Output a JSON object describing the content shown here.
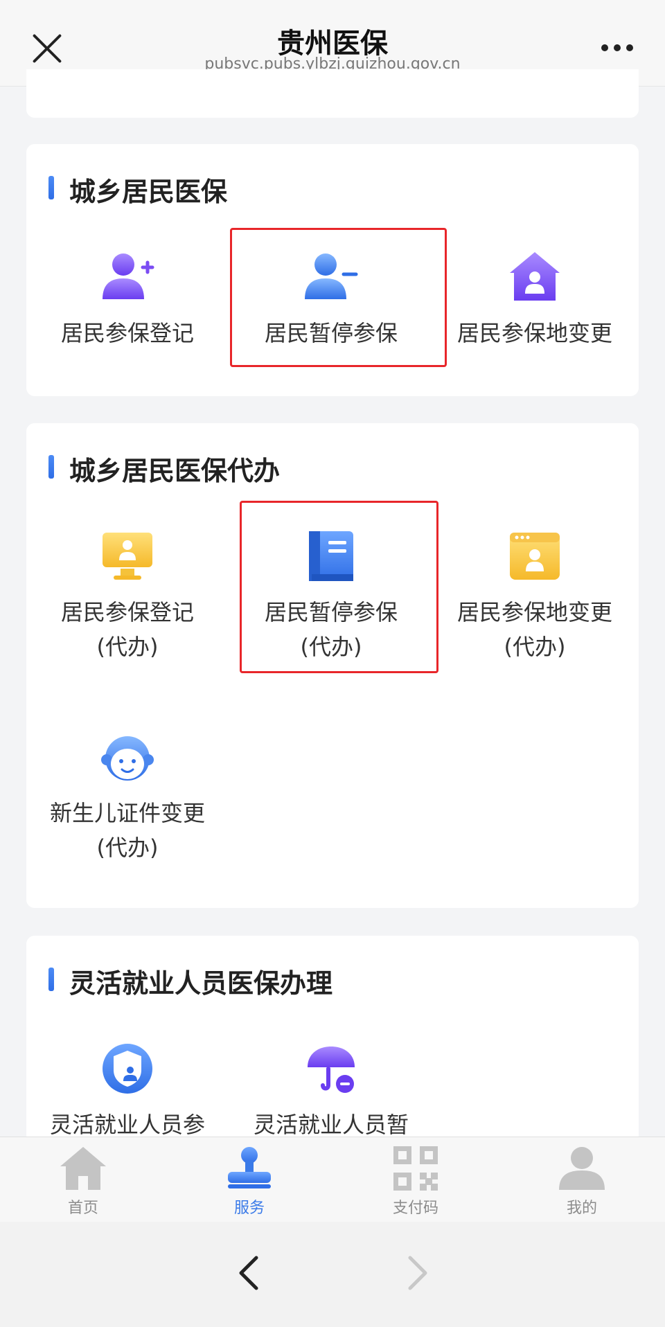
{
  "header": {
    "title": "贵州医保",
    "url": "pubsvc.pubs.ylbzj.guizhou.gov.cn"
  },
  "sections": [
    {
      "title": "城乡居民医保",
      "items": [
        {
          "label": "居民参保登记",
          "icon": "person-add-icon"
        },
        {
          "label": "居民暂停参保",
          "icon": "person-remove-icon"
        },
        {
          "label": "居民参保地变更",
          "icon": "home-person-icon"
        }
      ]
    },
    {
      "title": "城乡居民医保代办",
      "items": [
        {
          "label": "居民参保登记",
          "sub": "(代办)",
          "icon": "monitor-person-icon"
        },
        {
          "label": "居民暂停参保",
          "sub": "(代办)",
          "icon": "book-icon"
        },
        {
          "label": "居民参保地变更",
          "sub": "(代办)",
          "icon": "browser-person-icon"
        },
        {
          "label": "新生儿证件变更",
          "sub": "(代办)",
          "icon": "baby-face-icon"
        }
      ]
    },
    {
      "title": "灵活就业人员医保办理",
      "items": [
        {
          "label": "灵活就业人员参",
          "icon": "shield-person-icon"
        },
        {
          "label": "灵活就业人员暂",
          "icon": "umbrella-icon"
        }
      ]
    }
  ],
  "nav": [
    {
      "label": "首页",
      "icon": "home-icon",
      "active": false
    },
    {
      "label": "服务",
      "icon": "stamp-icon",
      "active": true
    },
    {
      "label": "支付码",
      "icon": "qr-code-icon",
      "active": false
    },
    {
      "label": "我的",
      "icon": "user-icon",
      "active": false
    }
  ],
  "colors": {
    "accent": "#3a7ae8",
    "highlight": "#e8262a"
  }
}
